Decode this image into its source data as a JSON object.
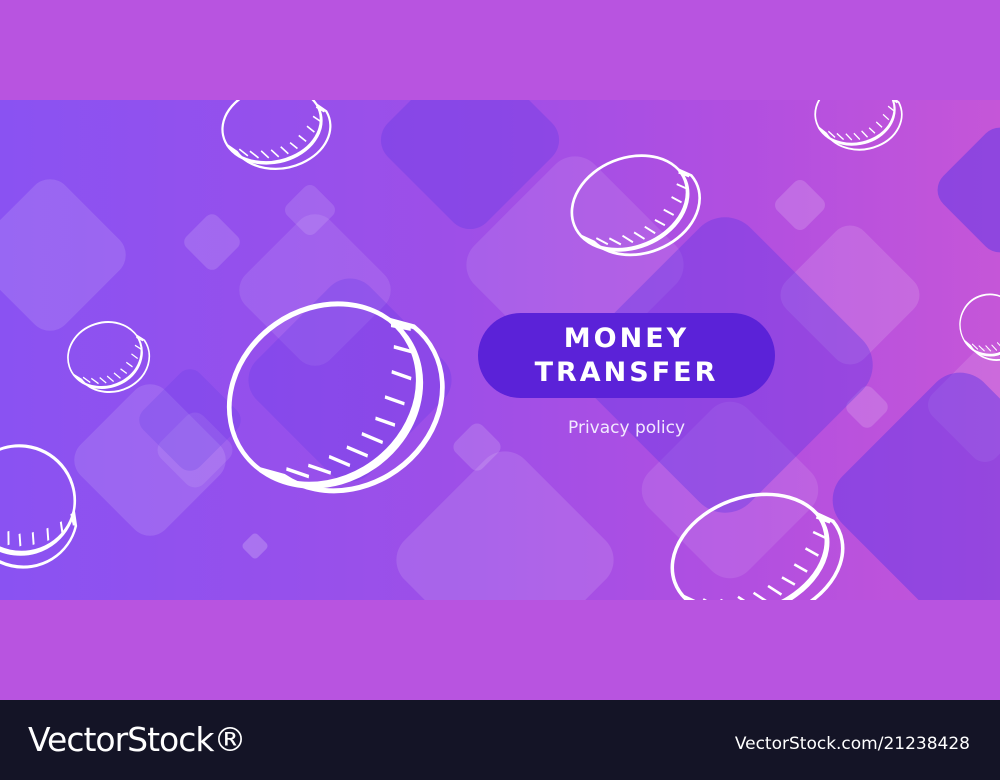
{
  "banner": {
    "title_line1": "MONEY",
    "title_line2": "TRANSFER",
    "link": "Privacy policy"
  },
  "footer": {
    "logo": "VectorStock®",
    "stock_id": "VectorStock.com/21238428"
  },
  "colors": {
    "background": "#b854e0",
    "pill": "#5b22d8",
    "footer": "#141426",
    "coin_outline": "#ffffff"
  },
  "icons": [
    "coin-icon"
  ]
}
